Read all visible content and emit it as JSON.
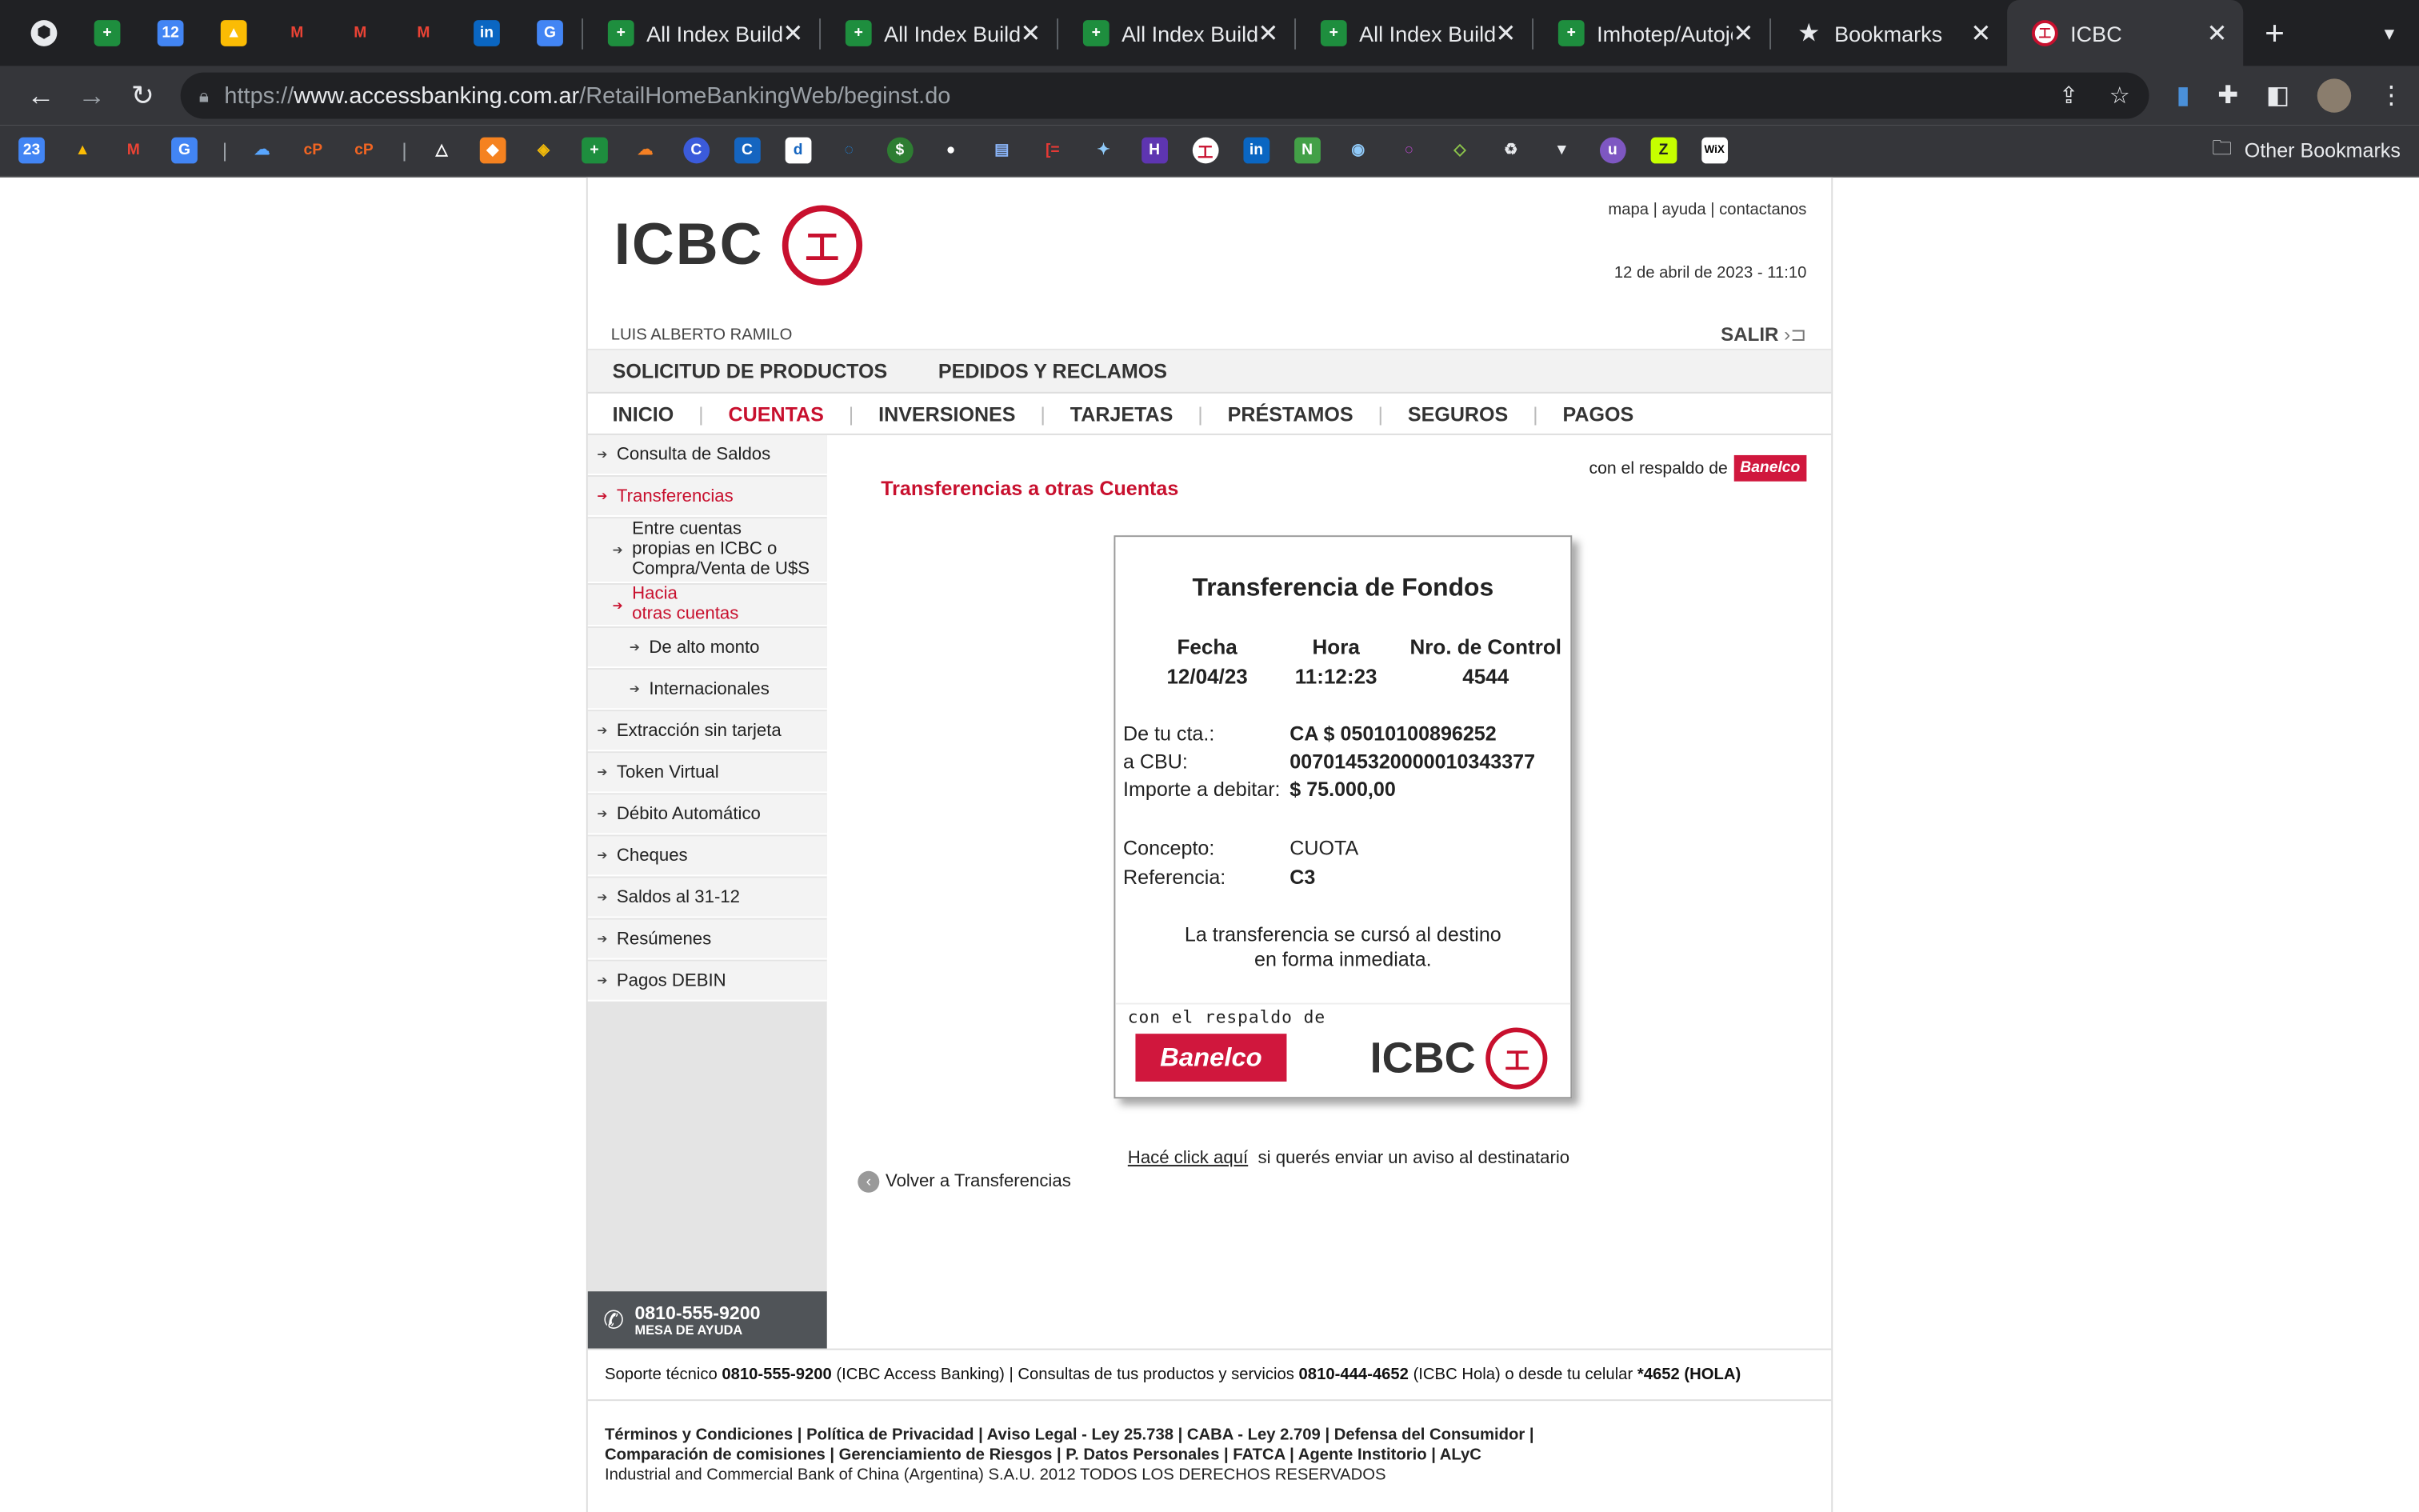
{
  "browser": {
    "tabs": [
      {
        "label": "All Index Builde"
      },
      {
        "label": "All Index Builde"
      },
      {
        "label": "All Index Builde"
      },
      {
        "label": "All Index Builde"
      },
      {
        "label": "Imhotep/Autojo"
      },
      {
        "label": "Bookmarks"
      },
      {
        "label": "ICBC"
      }
    ],
    "url_scheme": "https://",
    "url_host": "www.accessbanking.com.ar",
    "url_path": "/RetailHomeBankingWeb/beginst.do",
    "other_bookmarks": "Other Bookmarks"
  },
  "header": {
    "logo_text": "ICBC",
    "top_links": "mapa | ayuda | contactanos",
    "datetime": "12 de abril de 2023 - 11:10",
    "username": "LUIS ALBERTO RAMILO",
    "salir": "SALIR"
  },
  "menu_primary": [
    "SOLICITUD DE PRODUCTOS",
    "PEDIDOS Y RECLAMOS"
  ],
  "menu_secondary": [
    "INICIO",
    "CUENTAS",
    "INVERSIONES",
    "TARJETAS",
    "PRÉSTAMOS",
    "SEGUROS",
    "PAGOS"
  ],
  "sidebar": {
    "consulta": "Consulta de Saldos",
    "transferencias": "Transferencias",
    "entre_cuentas_1": "Entre cuentas",
    "entre_cuentas_2": "propias en ICBC o",
    "entre_cuentas_3": "Compra/Venta de U$S",
    "hacia_1": "Hacia",
    "hacia_2": "otras cuentas",
    "alto_monto": "De alto monto",
    "internacionales": "Internacionales",
    "extraccion": "Extracción sin tarjeta",
    "token": "Token Virtual",
    "debito": "Débito Automático",
    "cheques": "Cheques",
    "saldos": "Saldos al 31-12",
    "resumenes": "Resúmenes",
    "debin": "Pagos DEBIN",
    "help_number": "0810-555-9200",
    "help_label": "MESA DE AYUDA"
  },
  "content": {
    "respaldo": "con el respaldo de",
    "banelco": "Banelco",
    "page_title": "Transferencias a otras Cuentas",
    "aviso_link": "Hacé click aquí",
    "aviso_text": "si querés enviar un aviso al destinatario",
    "volver": "Volver a Transferencias"
  },
  "receipt": {
    "title": "Transferencia de Fondos",
    "fecha_label": "Fecha",
    "fecha": "12/04/23",
    "hora_label": "Hora",
    "hora": "11:12:23",
    "control_label": "Nro. de Control",
    "control": "4544",
    "de_cta_label": "De tu cta.:",
    "de_cta": "CA $ 05010100896252",
    "cbu_label": "a CBU:",
    "cbu": "0070145320000010343377",
    "importe_label": "Importe a debitar:",
    "importe": "$ 75.000,00",
    "concepto_label": "Concepto:",
    "concepto": "CUOTA",
    "referencia_label": "Referencia:",
    "referencia": "C3",
    "msg1": "La transferencia se cursó al destino",
    "msg2": "en forma inmediata.",
    "footer_respaldo": "con el respaldo de",
    "footer_banelco": "Banelco",
    "footer_icbc": "ICBC"
  },
  "footer": {
    "sup_1": "Soporte técnico",
    "sup_num1": "0810-555-9200",
    "sup_2": "(ICBC Access Banking)  |  Consultas de tus productos y servicios",
    "sup_num2": "0810-444-4652",
    "sup_3": "(ICBC Hola) o desde tu celular",
    "sup_num3": "*4652 (HOLA)",
    "legal_1": "Términos y Condiciones | Política de Privacidad | Aviso Legal - Ley 25.738 | CABA - Ley 2.709 | Defensa del Consumidor |",
    "legal_2": "Comparación de comisiones | Gerenciamiento de Riesgos | P. Datos Personales | FATCA | Agente Institorio | ALyC",
    "legal_3": "Industrial and Commercial Bank of China (Argentina) S.A.U. 2012 TODOS LOS DERECHOS RESERVADOS"
  }
}
